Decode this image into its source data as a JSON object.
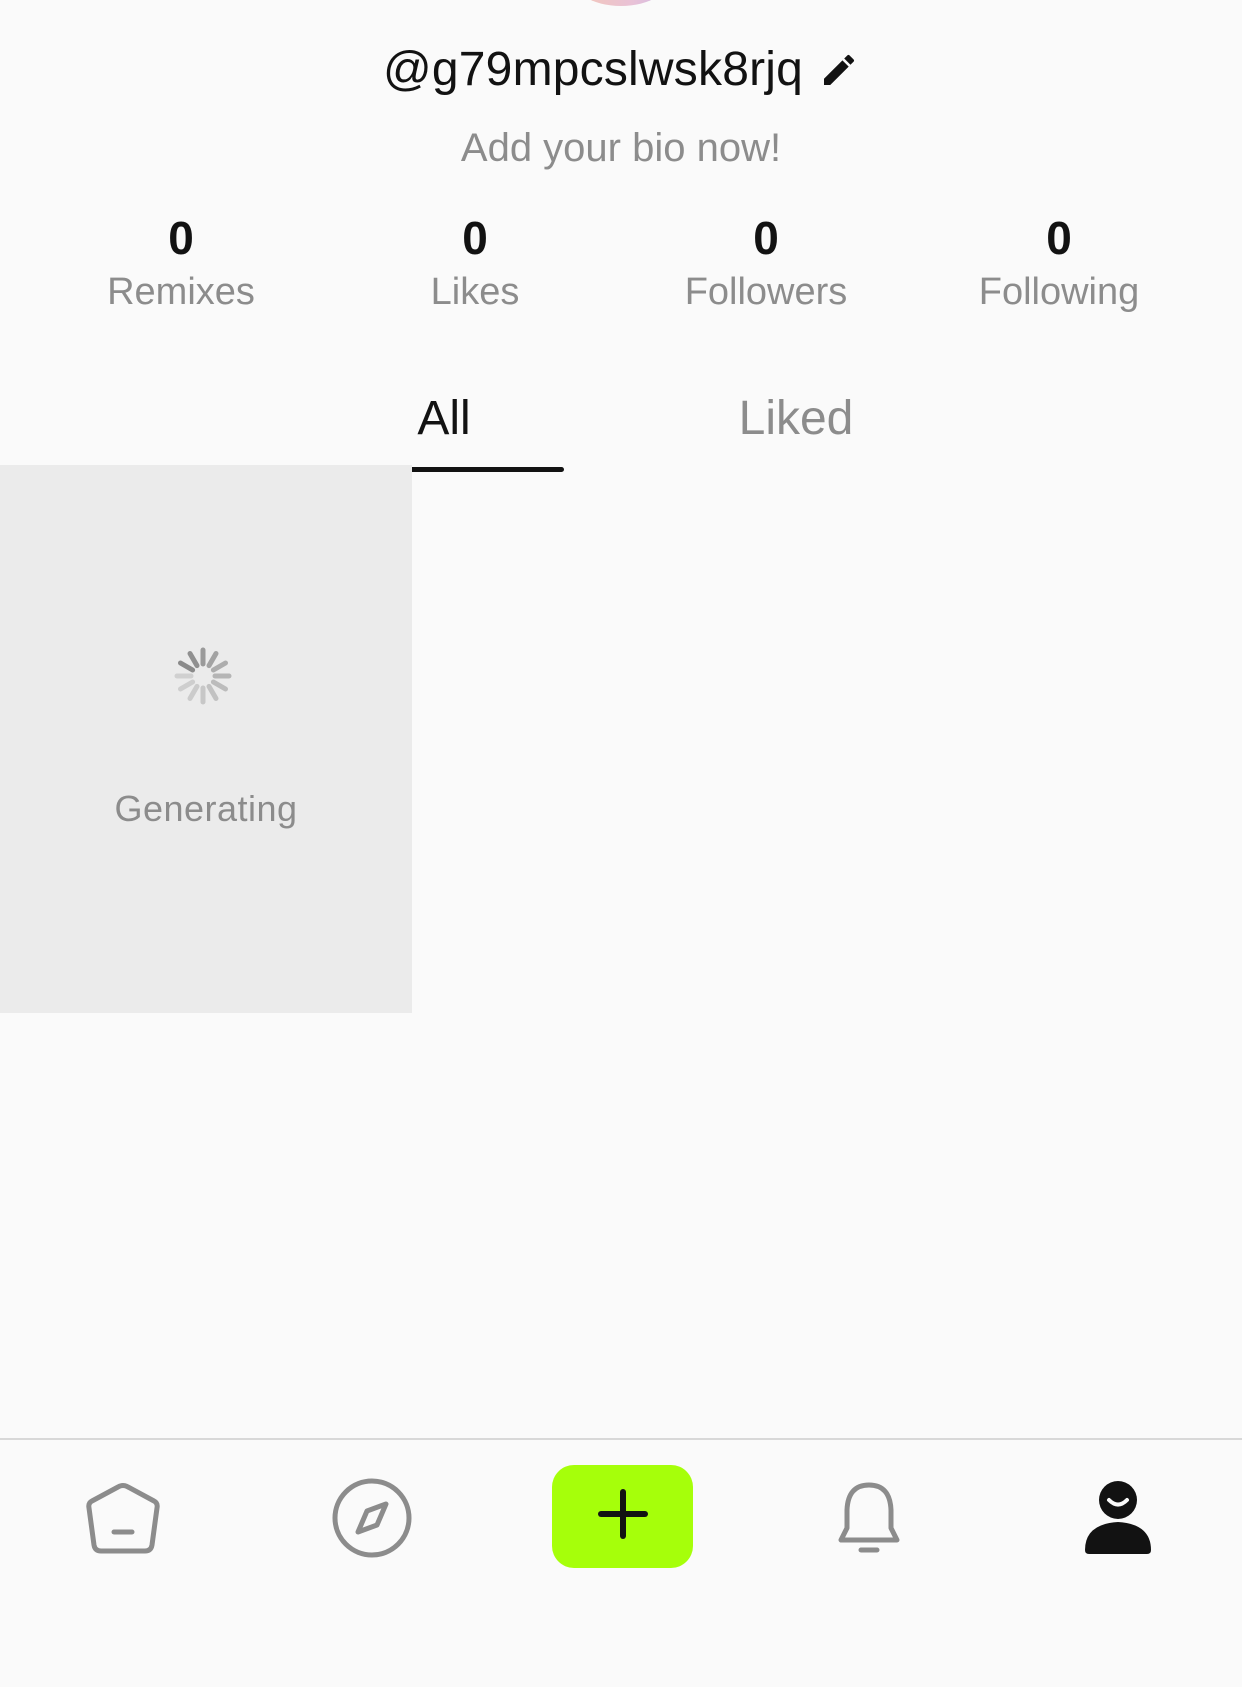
{
  "profile": {
    "username": "@g79mpcslwsk8rjq",
    "bio_placeholder": "Add your bio now!"
  },
  "stats": [
    {
      "value": "0",
      "label": "Remixes"
    },
    {
      "value": "0",
      "label": "Likes"
    },
    {
      "value": "0",
      "label": "Followers"
    },
    {
      "value": "0",
      "label": "Following"
    }
  ],
  "tabs": {
    "active": "All",
    "items": [
      {
        "label": "All"
      },
      {
        "label": "Liked"
      }
    ]
  },
  "grid": {
    "items": [
      {
        "status_label": "Generating"
      }
    ]
  },
  "navbar": {
    "icons": [
      "home-icon",
      "compass-icon",
      "plus-icon",
      "bell-icon",
      "profile-icon"
    ],
    "active": "profile-icon",
    "create_button_color": "#a6ff0a"
  },
  "colors": {
    "text_primary": "#121212",
    "text_secondary": "#8c8c8c",
    "background": "#fafafa",
    "card_placeholder": "#ebebeb",
    "accent": "#a6ff0a"
  }
}
